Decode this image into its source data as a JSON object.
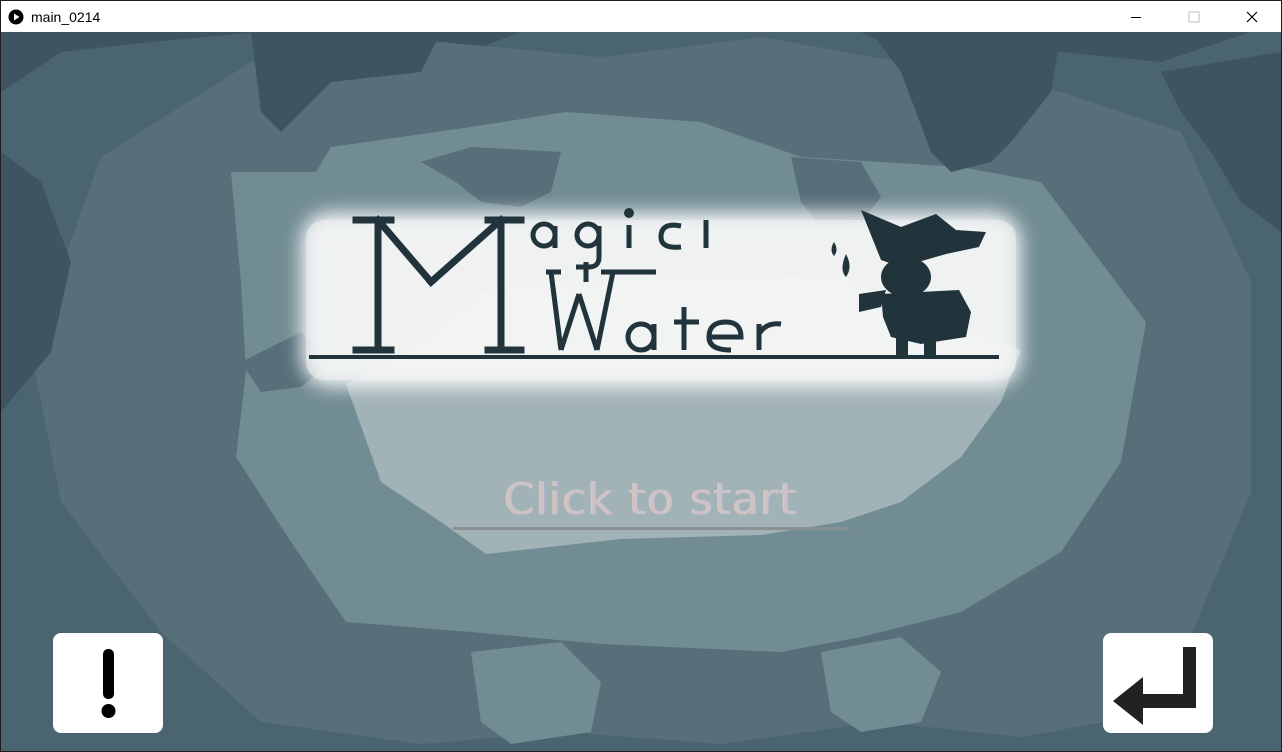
{
  "window": {
    "title": "main_0214",
    "controls": {
      "minimize": "minimize-icon",
      "maximize": "maximize-icon",
      "close": "close-icon"
    }
  },
  "game": {
    "logo": {
      "line1": "Magic",
      "line2": "Water"
    },
    "start_prompt": "Click to start",
    "info_button_icon": "exclamation-icon",
    "return_button_icon": "return-arrow-icon"
  },
  "colors": {
    "bg_dark": "#3e5561",
    "bg_mid": "#556f79",
    "bg_light": "#748f96",
    "bg_pale": "#a3b4b8",
    "logo_ink": "#21333b"
  }
}
